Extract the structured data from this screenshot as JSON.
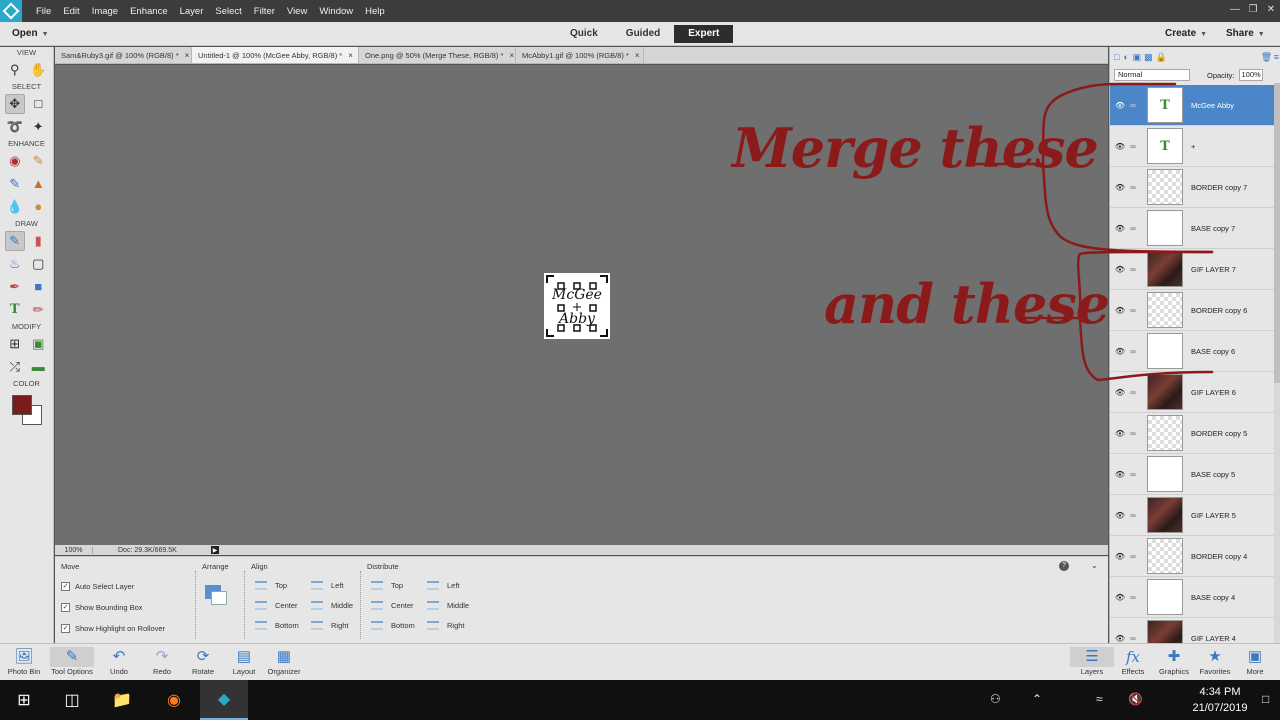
{
  "menubar": {
    "items": [
      "File",
      "Edit",
      "Image",
      "Enhance",
      "Layer",
      "Select",
      "Filter",
      "View",
      "Window",
      "Help"
    ]
  },
  "modebar": {
    "open": "Open",
    "tabs": [
      "Quick",
      "Guided",
      "Expert"
    ],
    "active_tab": "Expert",
    "create": "Create",
    "share": "Share"
  },
  "toolbox": {
    "sections": {
      "view": "VIEW",
      "select": "SELECT",
      "enhance": "ENHANCE",
      "draw": "DRAW",
      "modify": "MODIFY",
      "color": "COLOR"
    },
    "foreground_color": "#7a1c1c",
    "background_color": "#ffffff"
  },
  "doc_tabs": [
    "Sam&Ruby3.gif @ 100% (RGB/8) *",
    "Untitled-1 @ 100% (McGee Abby, RGB/8) *",
    "One.png @ 50% (Merge These, RGB/8) *",
    "McAbby1.gif @ 100% (RGB/8) *"
  ],
  "canvas": {
    "text_line1": "McGee",
    "text_line2": "Abby"
  },
  "statusbar": {
    "zoom": "100%",
    "doc": "Doc: 29.3K/669.5K"
  },
  "tool_options": {
    "move": "Move",
    "auto_select": "Auto Select Layer",
    "bounding_box": "Show Bounding Box",
    "highlight": "Show Highlight on Rollover",
    "arrange": "Arrange",
    "align": "Align",
    "align_items": [
      "Top",
      "Center",
      "Bottom",
      "Left",
      "Middle",
      "Right"
    ],
    "distribute": "Distribute",
    "distribute_items": [
      "Top",
      "Center",
      "Bottom",
      "Left",
      "Middle",
      "Right"
    ]
  },
  "layers_panel": {
    "blend_mode": "Normal",
    "opacity_label": "Opacity:",
    "opacity_value": "100%",
    "layers": [
      {
        "name": "McGee Abby",
        "type": "text"
      },
      {
        "name": "+",
        "type": "text"
      },
      {
        "name": "BORDER copy 7",
        "type": "checker"
      },
      {
        "name": "BASE copy 7",
        "type": "white"
      },
      {
        "name": "GIF LAYER 7",
        "type": "photo"
      },
      {
        "name": "BORDER copy 6",
        "type": "checker"
      },
      {
        "name": "BASE copy 6",
        "type": "white"
      },
      {
        "name": "GIF LAYER 6",
        "type": "photo"
      },
      {
        "name": "BORDER copy 5",
        "type": "checker"
      },
      {
        "name": "BASE copy 5",
        "type": "white"
      },
      {
        "name": "GIF LAYER 5",
        "type": "photo"
      },
      {
        "name": "BORDER copy 4",
        "type": "checker"
      },
      {
        "name": "BASE copy 4",
        "type": "white"
      },
      {
        "name": "GIF LAYER 4",
        "type": "photo"
      }
    ]
  },
  "annotations": {
    "merge": "Merge these",
    "and": "and these"
  },
  "panelbar": {
    "left": [
      "Photo Bin",
      "Tool Options",
      "Undo",
      "Redo",
      "Rotate",
      "Layout",
      "Organizer"
    ],
    "right": [
      "Layers",
      "Effects",
      "Graphics",
      "Favorites",
      "More"
    ]
  },
  "taskbar": {
    "time": "4:34 PM",
    "date": "21/07/2019"
  }
}
